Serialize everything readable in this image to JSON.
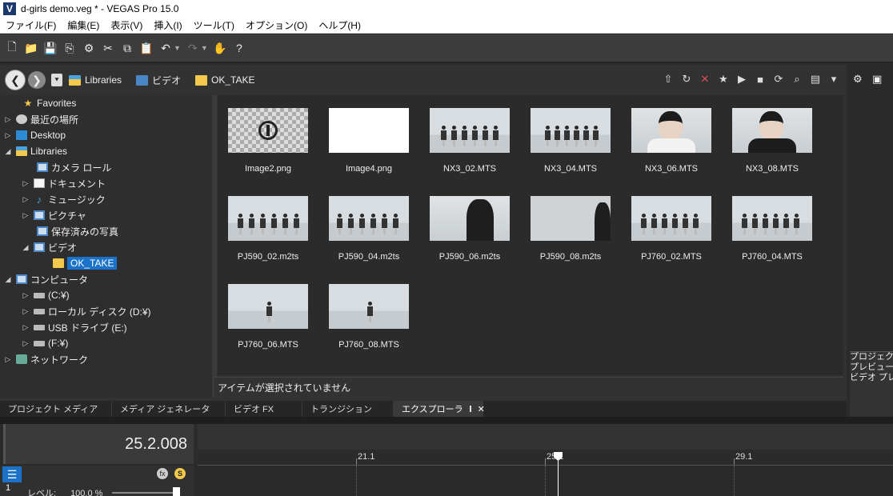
{
  "window": {
    "title": "d-girls demo.veg * - VEGAS Pro 15.0",
    "app_icon": "V"
  },
  "menu": [
    "ファイル(F)",
    "編集(E)",
    "表示(V)",
    "挿入(I)",
    "ツール(T)",
    "オプション(O)",
    "ヘルプ(H)"
  ],
  "breadcrumbs": [
    "Libraries",
    "ビデオ",
    "OK_TAKE"
  ],
  "tree": [
    {
      "label": "Favorites"
    },
    {
      "label": "最近の場所"
    },
    {
      "label": "Desktop"
    },
    {
      "label": "Libraries"
    },
    {
      "label": "カメラ ロール"
    },
    {
      "label": "ドキュメント"
    },
    {
      "label": "ミュージック"
    },
    {
      "label": "ピクチャ"
    },
    {
      "label": "保存済みの写真"
    },
    {
      "label": "ビデオ"
    },
    {
      "label": "OK_TAKE"
    },
    {
      "label": "コンピュータ"
    },
    {
      "label": "(C:¥)"
    },
    {
      "label": "ローカル ディスク (D:¥)"
    },
    {
      "label": "USB ドライブ (E:)"
    },
    {
      "label": "(F:¥)"
    },
    {
      "label": "ネットワーク"
    }
  ],
  "files": [
    {
      "name": "Image2.png"
    },
    {
      "name": "Image4.png"
    },
    {
      "name": "NX3_02.MTS"
    },
    {
      "name": "NX3_04.MTS"
    },
    {
      "name": "NX3_06.MTS"
    },
    {
      "name": "NX3_08.MTS"
    },
    {
      "name": "PJ590_02.m2ts"
    },
    {
      "name": "PJ590_04.m2ts"
    },
    {
      "name": "PJ590_06.m2ts"
    },
    {
      "name": "PJ590_08.m2ts"
    },
    {
      "name": "PJ760_02.MTS"
    },
    {
      "name": "PJ760_04.MTS"
    },
    {
      "name": "PJ760_06.MTS"
    },
    {
      "name": "PJ760_08.MTS"
    }
  ],
  "status": "アイテムが選択されていません",
  "tabs": [
    "プロジェクト メディア",
    "メディア ジェネレータ",
    "ビデオ FX",
    "トランジション",
    "エクスプローラ"
  ],
  "right_panel_labels": [
    "プロジェクト",
    "プレビュー:",
    "ビデオ プレ"
  ],
  "timeline": {
    "timecode": "25.2.008",
    "ruler_marks": [
      "21.1",
      "25.1",
      "29.1"
    ],
    "track_number": "1",
    "level_label": "レベル:",
    "level_value": "100.0 %"
  },
  "colors": {
    "accent": "#1b73c9",
    "panel": "#2b2b2b"
  }
}
